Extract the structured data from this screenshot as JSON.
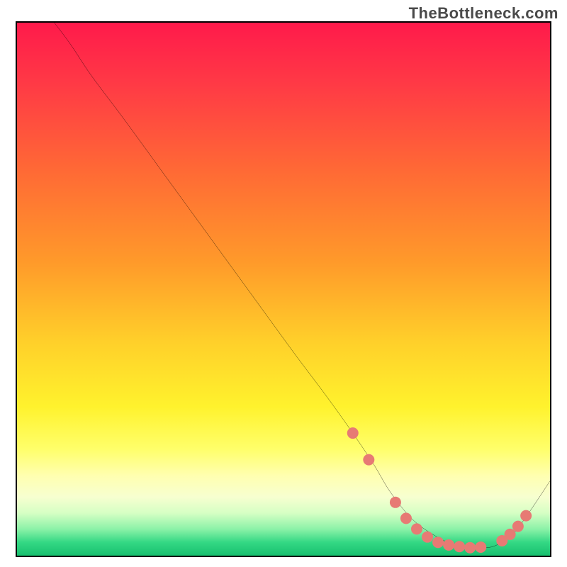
{
  "watermark": "TheBottleneck.com",
  "chart_data": {
    "type": "line",
    "title": "",
    "xlabel": "",
    "ylabel": "",
    "xlim": [
      0,
      100
    ],
    "ylim": [
      0,
      100
    ],
    "grid": false,
    "legend": false,
    "background_gradient_stops": [
      {
        "offset": 0.0,
        "color": "#ff1a4b"
      },
      {
        "offset": 0.12,
        "color": "#ff3b45"
      },
      {
        "offset": 0.28,
        "color": "#ff6a35"
      },
      {
        "offset": 0.45,
        "color": "#ff9a2a"
      },
      {
        "offset": 0.6,
        "color": "#ffd02a"
      },
      {
        "offset": 0.72,
        "color": "#fff22d"
      },
      {
        "offset": 0.8,
        "color": "#ffff6a"
      },
      {
        "offset": 0.85,
        "color": "#ffffb0"
      },
      {
        "offset": 0.89,
        "color": "#f7ffd0"
      },
      {
        "offset": 0.92,
        "color": "#d6ffc4"
      },
      {
        "offset": 0.95,
        "color": "#8cf2a8"
      },
      {
        "offset": 0.975,
        "color": "#34d884"
      },
      {
        "offset": 1.0,
        "color": "#18c06f"
      }
    ],
    "series": [
      {
        "name": "bottleneck-curve",
        "color": "#000000",
        "x": [
          7,
          10,
          14,
          20,
          28,
          36,
          44,
          52,
          58,
          63,
          67,
          70,
          74,
          78,
          82,
          85,
          88,
          90,
          93,
          96,
          100
        ],
        "y": [
          100,
          96,
          90,
          82,
          71,
          60,
          49,
          38,
          30,
          23,
          17,
          12,
          7,
          4,
          2,
          1.5,
          1.5,
          2,
          4,
          8,
          14
        ]
      }
    ],
    "markers": {
      "name": "highlight-dots",
      "color": "#e77a74",
      "radius": 8,
      "points": [
        {
          "x": 63,
          "y": 23
        },
        {
          "x": 66,
          "y": 18
        },
        {
          "x": 71,
          "y": 10
        },
        {
          "x": 73,
          "y": 7
        },
        {
          "x": 75,
          "y": 5
        },
        {
          "x": 77,
          "y": 3.5
        },
        {
          "x": 79,
          "y": 2.5
        },
        {
          "x": 81,
          "y": 2
        },
        {
          "x": 83,
          "y": 1.7
        },
        {
          "x": 85,
          "y": 1.5
        },
        {
          "x": 87,
          "y": 1.6
        },
        {
          "x": 91,
          "y": 2.8
        },
        {
          "x": 92.5,
          "y": 4
        },
        {
          "x": 94,
          "y": 5.5
        },
        {
          "x": 95.5,
          "y": 7.5
        }
      ]
    }
  }
}
